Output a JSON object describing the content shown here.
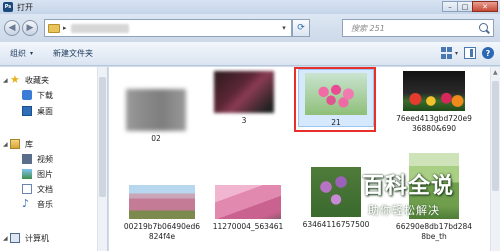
{
  "window": {
    "title": "打开",
    "app_icon": "Ps"
  },
  "window_controls": {
    "minimize": "–",
    "maximize": "□",
    "close": "✕"
  },
  "address": {
    "back": "◀",
    "forward": "▶",
    "chevron": "▸",
    "dropdown": "▾",
    "refresh": "⟳"
  },
  "search": {
    "placeholder": "搜索 251"
  },
  "toolbar": {
    "organize": "组织",
    "organize_chevron": "▾",
    "new_folder": "新建文件夹",
    "help": "?"
  },
  "sidebar": {
    "items": [
      {
        "label": "收藏夹",
        "icon": "star-icon"
      },
      {
        "label": "下载",
        "icon": "download-icon"
      },
      {
        "label": "桌面",
        "icon": "desktop-icon"
      },
      {
        "label": "库",
        "icon": "library-icon"
      },
      {
        "label": "视频",
        "icon": "video-icon"
      },
      {
        "label": "图片",
        "icon": "pictures-icon"
      },
      {
        "label": "文档",
        "icon": "documents-icon"
      },
      {
        "label": "音乐",
        "icon": "music-icon"
      },
      {
        "label": "计算机",
        "icon": "computer-icon"
      }
    ]
  },
  "files": [
    {
      "name": "02"
    },
    {
      "name": "3"
    },
    {
      "name": "21",
      "selected": true
    },
    {
      "name": "76eed413gbd720e936880&690"
    },
    {
      "name": "00219b7b06490ed6824f4e"
    },
    {
      "name": "11270004_563461"
    },
    {
      "name": "63464116757500"
    },
    {
      "name": "66290e8db17bd2848be_th"
    }
  ],
  "watermark": {
    "title": "百科全说",
    "subtitle": "助你轻松解决"
  }
}
